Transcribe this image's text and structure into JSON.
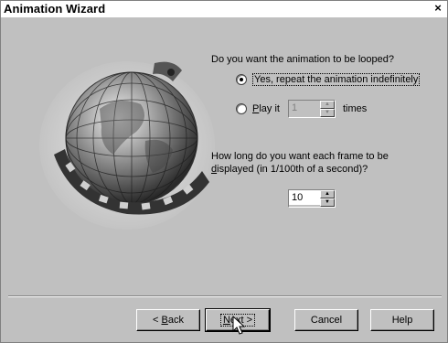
{
  "window": {
    "title": "Animation Wizard",
    "close_glyph": "×"
  },
  "loop": {
    "question": "Do you want the animation to be looped?",
    "option_repeat": "Yes, repeat the animation indefinitely",
    "option_play_prefix": "P",
    "option_play_rest": "lay it",
    "play_count": "1",
    "times_label": "times",
    "selected": "repeat"
  },
  "frame": {
    "question_line1": "How long do you want each frame to be",
    "question_line2_prefix": "d",
    "question_line2_rest": "isplayed (in 1/100th of a second)?",
    "duration_value": "10"
  },
  "buttons": {
    "back_prefix": "< ",
    "back_accel": "B",
    "back_rest": "ack",
    "next_accel": "N",
    "next_rest": "ext >",
    "cancel": "Cancel",
    "help": "Help"
  },
  "spin_glyphs": {
    "up": "▲",
    "down": "▼"
  },
  "colors": {
    "face": "#c0c0c0",
    "shadow": "#808080",
    "highlight": "#ffffff"
  }
}
